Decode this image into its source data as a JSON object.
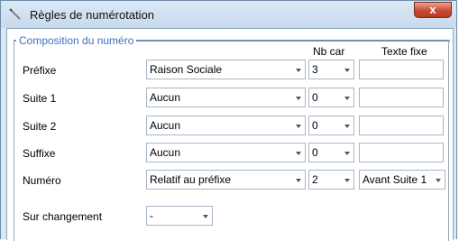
{
  "window": {
    "title": "Règles de numérotation",
    "close_label": "x"
  },
  "group": {
    "title": "Composition du numéro"
  },
  "columns": {
    "nb_car": "Nb car",
    "texte_fixe": "Texte fixe"
  },
  "rows": [
    {
      "label": "Préfixe",
      "type_value": "Raison Sociale",
      "nbcar_value": "3",
      "texte_value": ""
    },
    {
      "label": "Suite 1",
      "type_value": "Aucun",
      "nbcar_value": "0",
      "texte_value": ""
    },
    {
      "label": "Suite 2",
      "type_value": "Aucun",
      "nbcar_value": "0",
      "texte_value": ""
    },
    {
      "label": "Suffixe",
      "type_value": "Aucun",
      "nbcar_value": "0",
      "texte_value": ""
    },
    {
      "label": "Numéro",
      "type_value": "Relatif au préfixe",
      "nbcar_value": "2",
      "position_value": "Avant Suite 1"
    }
  ],
  "changement": {
    "label": "Sur changement",
    "value": "-"
  }
}
